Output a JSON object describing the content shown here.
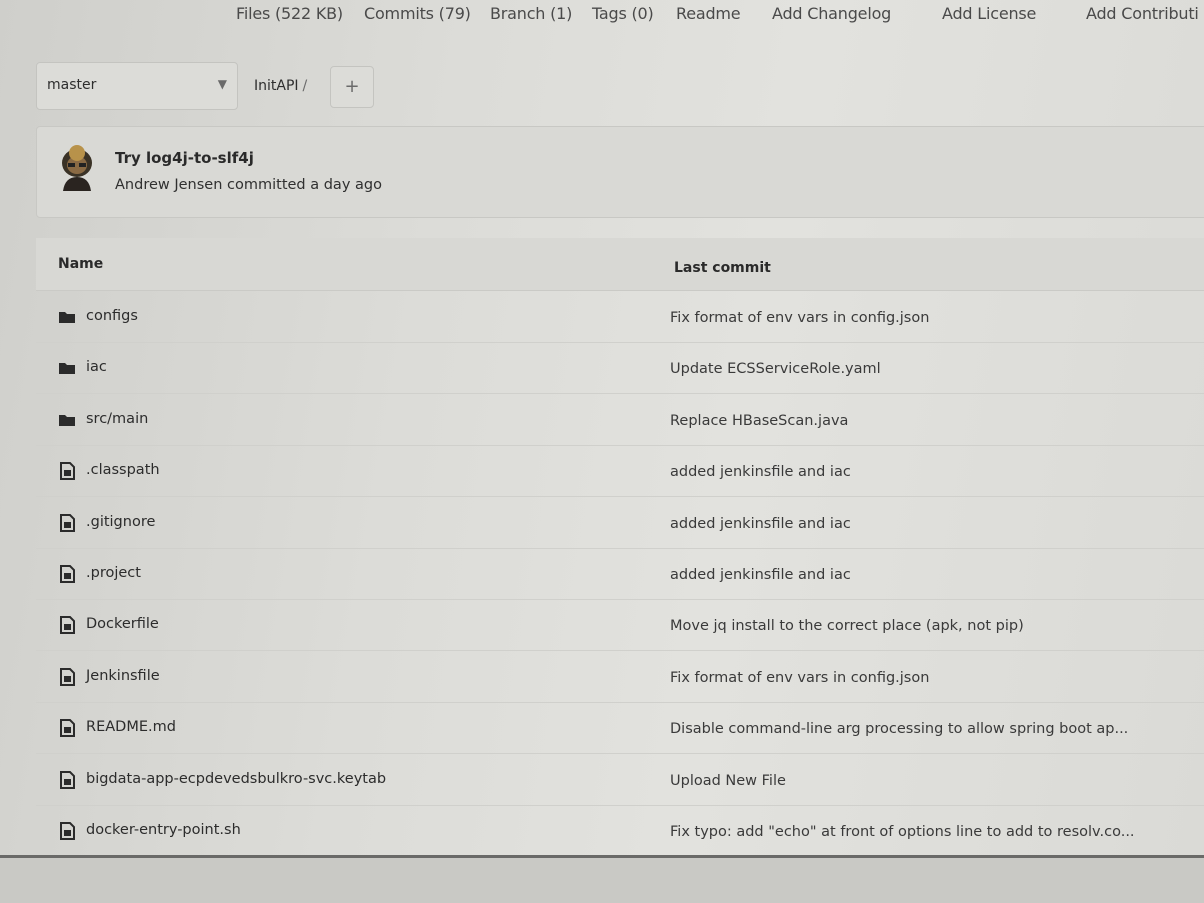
{
  "topnav": {
    "files": "Files (522 KB)",
    "commits": "Commits (79)",
    "branch": "Branch (1)",
    "tags": "Tags (0)",
    "readme": "Readme",
    "add_changelog": "Add Changelog",
    "add_license": "Add License",
    "add_contributing": "Add Contributi"
  },
  "branch_selector": {
    "value": "master"
  },
  "breadcrumb": {
    "repo": "InitAPI",
    "separator": "/"
  },
  "add_button": {
    "label": "+"
  },
  "last_commit": {
    "title": "Try log4j-to-slf4j",
    "meta": "Andrew Jensen committed a day ago"
  },
  "table": {
    "headers": {
      "name": "Name",
      "last_commit": "Last commit"
    },
    "rows": [
      {
        "name": "configs",
        "type": "folder",
        "icon": "folder-icon",
        "commit": "Fix format of env vars in config.json"
      },
      {
        "name": "iac",
        "type": "folder",
        "icon": "folder-icon",
        "commit": "Update ECSServiceRole.yaml"
      },
      {
        "name": "src/main",
        "type": "folder",
        "icon": "folder-icon",
        "commit": "Replace HBaseScan.java"
      },
      {
        "name": ".classpath",
        "type": "file",
        "icon": "file-icon",
        "commit": "added jenkinsfile and iac"
      },
      {
        "name": ".gitignore",
        "type": "file",
        "icon": "file-icon",
        "commit": "added jenkinsfile and iac"
      },
      {
        "name": ".project",
        "type": "file",
        "icon": "file-icon",
        "commit": "added jenkinsfile and iac"
      },
      {
        "name": "Dockerfile",
        "type": "file",
        "icon": "file-icon",
        "commit": "Move jq install to the correct place (apk, not pip)"
      },
      {
        "name": "Jenkinsfile",
        "type": "file",
        "icon": "file-icon",
        "commit": "Fix format of env vars in config.json"
      },
      {
        "name": "README.md",
        "type": "file",
        "icon": "file-icon",
        "commit": "Disable command-line arg processing to allow spring boot ap..."
      },
      {
        "name": "bigdata-app-ecpdevedsbulkro-svc.keytab",
        "type": "file",
        "icon": "file-icon",
        "commit": "Upload New File"
      },
      {
        "name": "docker-entry-point.sh",
        "type": "file",
        "icon": "file-icon",
        "commit": "Fix typo: add \"echo\" at front of options line to add to resolv.co..."
      }
    ]
  }
}
